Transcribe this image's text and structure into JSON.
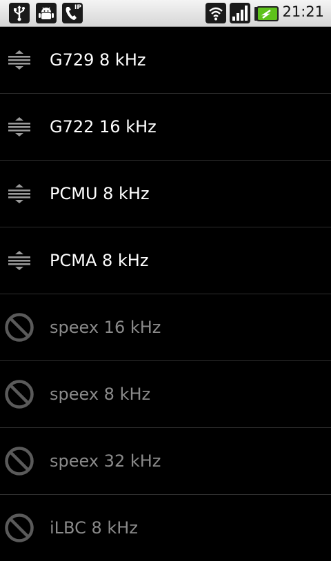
{
  "status_bar": {
    "time": "21:21",
    "left_icons": [
      "usb-icon",
      "android-debug-icon",
      "sip-phone-icon"
    ],
    "right_icons": [
      "wifi-icon",
      "signal-icon",
      "battery-charging-icon"
    ],
    "sip_badge": "IP"
  },
  "codecs": [
    {
      "label": "G729 8 kHz",
      "enabled": true
    },
    {
      "label": "G722 16 kHz",
      "enabled": true
    },
    {
      "label": "PCMU 8 kHz",
      "enabled": true
    },
    {
      "label": "PCMA 8 kHz",
      "enabled": true
    },
    {
      "label": "speex 16 kHz",
      "enabled": false
    },
    {
      "label": "speex 8 kHz",
      "enabled": false
    },
    {
      "label": "speex 32 kHz",
      "enabled": false
    },
    {
      "label": "iLBC 8 kHz",
      "enabled": false
    }
  ],
  "colors": {
    "enabled_text": "#ffffff",
    "disabled_text": "#8a8a8a",
    "background": "#000000"
  }
}
